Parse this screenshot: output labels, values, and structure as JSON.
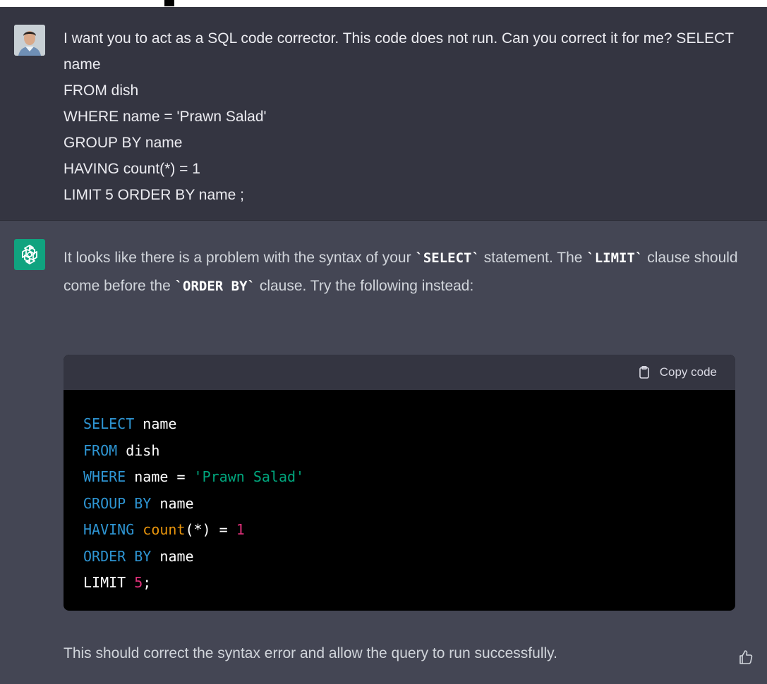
{
  "conversation": {
    "user_message": {
      "text": "I want you to act as a SQL code corrector. This code does not run. Can you correct it for me? SELECT name\nFROM dish\nWHERE name = 'Prawn Salad'\nGROUP BY name\nHAVING count(*) = 1\nLIMIT 5 ORDER BY name ;"
    },
    "assistant_message": {
      "intro_before_select": "It looks like there is a problem with the syntax of your ",
      "code_select": "`SELECT`",
      "intro_after_select": " statement. The ",
      "code_limit": "`LIMIT`",
      "intro_mid": " clause should come before the ",
      "code_order_by": "`ORDER BY`",
      "intro_end": " clause. Try the following instead:",
      "copy_label": "Copy code",
      "code_lines": [
        [
          {
            "t": "SELECT",
            "c": "kw"
          },
          {
            "t": " name",
            "c": ""
          }
        ],
        [
          {
            "t": "FROM",
            "c": "kw"
          },
          {
            "t": " dish",
            "c": ""
          }
        ],
        [
          {
            "t": "WHERE",
            "c": "kw"
          },
          {
            "t": " name = ",
            "c": ""
          },
          {
            "t": "'Prawn Salad'",
            "c": "str"
          }
        ],
        [
          {
            "t": "GROUP",
            "c": "kw"
          },
          {
            "t": " ",
            "c": ""
          },
          {
            "t": "BY",
            "c": "kw"
          },
          {
            "t": " name",
            "c": ""
          }
        ],
        [
          {
            "t": "HAVING",
            "c": "kw"
          },
          {
            "t": " ",
            "c": ""
          },
          {
            "t": "count",
            "c": "fn2"
          },
          {
            "t": "(*) = ",
            "c": ""
          },
          {
            "t": "1",
            "c": "num"
          }
        ],
        [
          {
            "t": "ORDER",
            "c": "kw"
          },
          {
            "t": " ",
            "c": ""
          },
          {
            "t": "BY",
            "c": "kw"
          },
          {
            "t": " name",
            "c": ""
          }
        ],
        [
          {
            "t": "LIMIT ",
            "c": ""
          },
          {
            "t": "5",
            "c": "num"
          },
          {
            "t": ";",
            "c": ""
          }
        ]
      ],
      "outro": "This should correct the syntax error and allow the query to run successfully."
    }
  },
  "icons": {
    "assistant_avatar": "openai-logo-icon",
    "copy": "clipboard-icon",
    "feedback": "thumbs-up-icon"
  },
  "colors": {
    "user_bg": "#343541",
    "assistant_bg": "#444654",
    "code_bg": "#000000",
    "keyword": "#2e95d3",
    "string": "#00a67d",
    "number": "#df3079",
    "function": "#e9950c"
  }
}
